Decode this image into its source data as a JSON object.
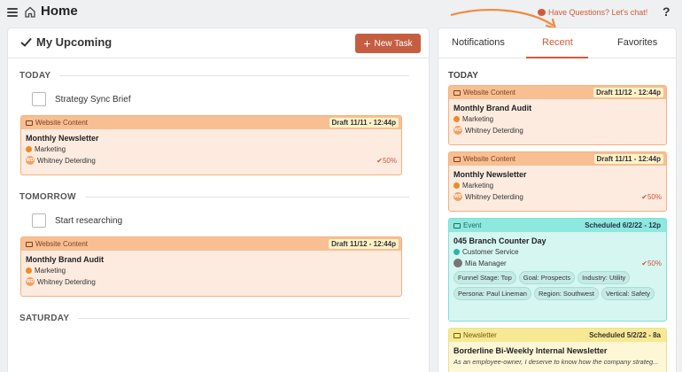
{
  "header": {
    "title": "Home",
    "help_link": "Have Questions? Let's chat!",
    "help_icon": "?"
  },
  "upcoming": {
    "title": "My Upcoming",
    "new_task_label": "New Task",
    "sections": {
      "today": "TODAY",
      "tomorrow": "TOMORROW",
      "saturday": "SATURDAY"
    },
    "tasks": {
      "today_task": "Strategy Sync Brief",
      "tomorrow_task": "Start researching"
    },
    "cards": [
      {
        "type": "Website Content",
        "status": "Draft 11/11 - 12:44p",
        "title": "Monthly Newsletter",
        "category": "Marketing",
        "user_initials": "WD",
        "user": "Whitney Deterding",
        "progress": "50%"
      },
      {
        "type": "Website Content",
        "status": "Draft 11/12 - 12:44p",
        "title": "Monthly Brand Audit",
        "category": "Marketing",
        "user_initials": "WD",
        "user": "Whitney Deterding"
      }
    ]
  },
  "sidebar": {
    "tabs": [
      "Notifications",
      "Recent",
      "Favorites"
    ],
    "active_tab": "Recent",
    "section": "TODAY",
    "cards": [
      {
        "type": "Website Content",
        "status": "Draft 11/12 - 12:44p",
        "title": "Monthly Brand Audit",
        "category": "Marketing",
        "user_initials": "WD",
        "user": "Whitney Deterding"
      },
      {
        "type": "Website Content",
        "status": "Draft 11/11 - 12:44p",
        "title": "Monthly Newsletter",
        "category": "Marketing",
        "user_initials": "WD",
        "user": "Whitney Deterding",
        "progress": "50%"
      },
      {
        "type": "Event",
        "status": "Scheduled 6/2/22 - 12p",
        "title": "045 Branch Counter Day",
        "category": "Customer Service",
        "user": "Mia Manager",
        "progress": "50%",
        "tags": [
          "Funnel Stage: Top",
          "Goal: Prospects",
          "Industry: Utility",
          "Persona: Paul Lineman",
          "Region: Southwest",
          "Vertical: Safety"
        ]
      },
      {
        "type": "Newsletter",
        "status": "Scheduled 5/2/22 - 8a",
        "title": "Borderline Bi-Weekly Internal Newsletter",
        "description": "As an employee-owner, I deserve to know how the company strateg..."
      }
    ]
  },
  "colors": {
    "accent": "#d35a34",
    "new_task_bg": "#c55e41",
    "marketing_dot": "#f08a24",
    "customer_service_dot": "#2bb5a8",
    "progress": "#d2533a"
  },
  "icons": [
    "hamburger-icon",
    "home-icon",
    "checkmark-icon",
    "plus-icon",
    "chat-bubble-icon",
    "help-icon",
    "monitor-icon",
    "calendar-icon",
    "newsletter-icon"
  ]
}
